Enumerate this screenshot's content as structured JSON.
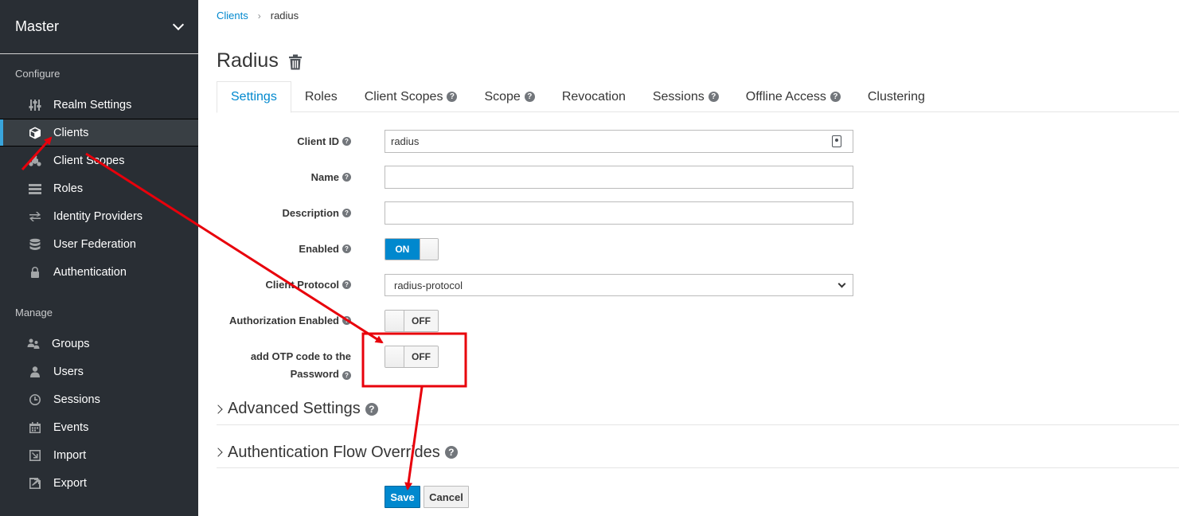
{
  "sidebar": {
    "realm": "Master",
    "configure_label": "Configure",
    "manage_label": "Manage",
    "configure_items": [
      {
        "label": "Realm Settings",
        "icon": "sliders-icon"
      },
      {
        "label": "Clients",
        "icon": "cube-icon"
      },
      {
        "label": "Client Scopes",
        "icon": "cubes-icon"
      },
      {
        "label": "Roles",
        "icon": "list-icon"
      },
      {
        "label": "Identity Providers",
        "icon": "exchange-icon"
      },
      {
        "label": "User Federation",
        "icon": "database-icon"
      },
      {
        "label": "Authentication",
        "icon": "lock-icon"
      }
    ],
    "manage_items": [
      {
        "label": "Groups",
        "icon": "users-icon"
      },
      {
        "label": "Users",
        "icon": "user-icon"
      },
      {
        "label": "Sessions",
        "icon": "clock-icon"
      },
      {
        "label": "Events",
        "icon": "calendar-icon"
      },
      {
        "label": "Import",
        "icon": "import-icon"
      },
      {
        "label": "Export",
        "icon": "export-icon"
      }
    ],
    "active_item": "Clients"
  },
  "breadcrumb": {
    "parent": "Clients",
    "current": "radius"
  },
  "page_title": "Radius",
  "tabs": [
    {
      "label": "Settings",
      "help": false,
      "active": true
    },
    {
      "label": "Roles",
      "help": false
    },
    {
      "label": "Client Scopes",
      "help": true
    },
    {
      "label": "Scope",
      "help": true
    },
    {
      "label": "Revocation",
      "help": false
    },
    {
      "label": "Sessions",
      "help": true
    },
    {
      "label": "Offline Access",
      "help": true
    },
    {
      "label": "Clustering",
      "help": false
    }
  ],
  "form": {
    "client_id_label": "Client ID",
    "client_id_value": "radius",
    "name_label": "Name",
    "name_value": "",
    "description_label": "Description",
    "description_value": "",
    "enabled_label": "Enabled",
    "enabled_state": "ON",
    "protocol_label": "Client Protocol",
    "protocol_value": "radius-protocol",
    "authz_label": "Authorization Enabled",
    "authz_state": "OFF",
    "otp_label_line1": "add OTP code to the",
    "otp_label_line2": "Password",
    "otp_state": "OFF"
  },
  "sections": {
    "advanced": "Advanced Settings",
    "auth_flow": "Authentication Flow Overrides"
  },
  "buttons": {
    "save": "Save",
    "cancel": "Cancel"
  },
  "colors": {
    "accent": "#0088ce",
    "sidebar_bg": "#292e34",
    "annotation": "#e8000b"
  }
}
